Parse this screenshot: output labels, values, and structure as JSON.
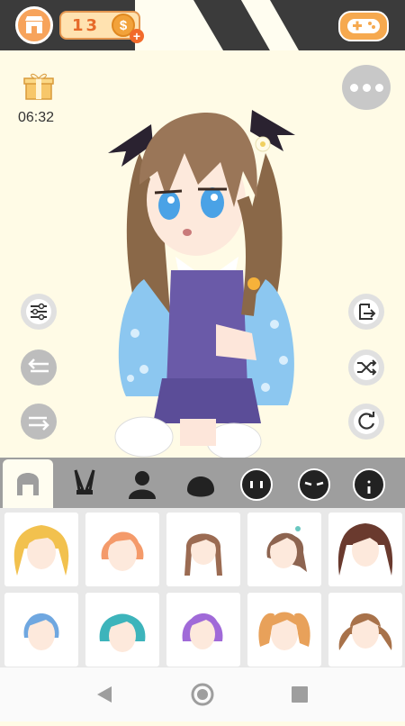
{
  "header": {
    "coin_count": "13",
    "coin_symbol": "$",
    "coin_plus": "+"
  },
  "gift": {
    "timer": "06:32"
  },
  "icons": {
    "shop": "shop-icon",
    "game": "gamepad-icon",
    "gift": "gift-icon",
    "more": "more-icon",
    "adjust": "sliders-icon",
    "undo": "undo-icon",
    "redo": "redo-icon",
    "export": "export-icon",
    "shuffle": "shuffle-icon",
    "reset": "reset-icon"
  },
  "category_tabs": [
    {
      "name": "hair",
      "active": true
    },
    {
      "name": "ears"
    },
    {
      "name": "body"
    },
    {
      "name": "head-shape"
    },
    {
      "name": "eyes"
    },
    {
      "name": "brows"
    },
    {
      "name": "mouth"
    }
  ],
  "hair_items": [
    {
      "style": "blonde-twintails",
      "color": "#f2c14e"
    },
    {
      "style": "orange-short",
      "color": "#f49a6a"
    },
    {
      "style": "brown-braids",
      "color": "#9b6b52"
    },
    {
      "style": "brown-side-ponytail",
      "color": "#8d6450"
    },
    {
      "style": "dark-twintails",
      "color": "#6a3a2e"
    },
    {
      "style": "blue-short",
      "color": "#6fa7e0"
    },
    {
      "style": "teal-short",
      "color": "#3db4bb"
    },
    {
      "style": "purple-bob",
      "color": "#a06ad8"
    },
    {
      "style": "orange-pigtails",
      "color": "#e8a15a"
    },
    {
      "style": "brown-wavy",
      "color": "#a8724a"
    }
  ],
  "character": {
    "hair_color": "#9a7658",
    "eye_color": "#4aa2e6",
    "vest_color": "#6a5aa8",
    "jacket_color": "#8cc7f0",
    "sock_color": "#ffffff"
  },
  "system_nav": [
    "back",
    "home",
    "recents"
  ]
}
